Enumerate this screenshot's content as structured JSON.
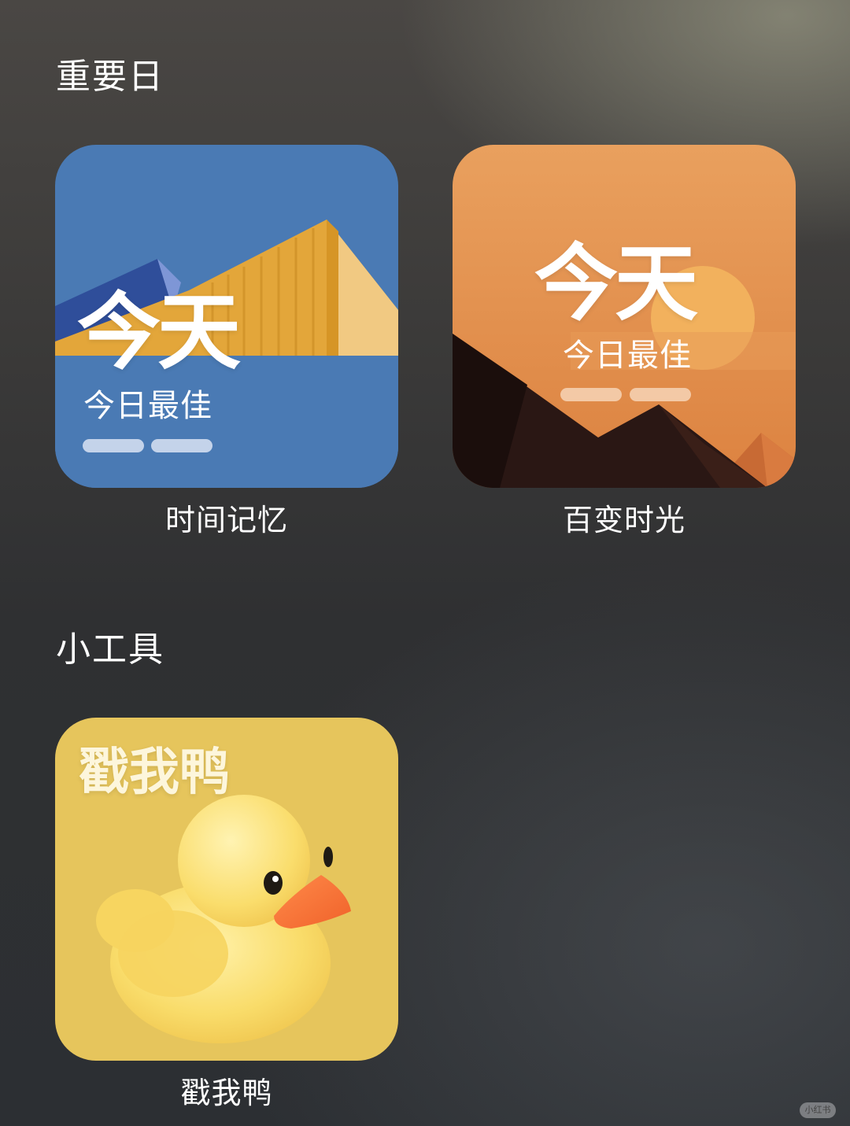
{
  "sections": [
    {
      "title": "重要日",
      "widgets": [
        {
          "headline": "今天",
          "subtitle": "今日最佳",
          "caption": "时间记忆",
          "theme_color": "#4a7ab4"
        },
        {
          "headline": "今天",
          "subtitle": "今日最佳",
          "caption": "百变时光",
          "theme_color": "#e38f4e"
        }
      ]
    },
    {
      "title": "小工具",
      "widgets": [
        {
          "headline": "戳我鸭",
          "caption": "戳我鸭",
          "icon": "rubber-duck-icon",
          "theme_color": "#e6c55c"
        }
      ]
    }
  ],
  "watermark": "小红书"
}
